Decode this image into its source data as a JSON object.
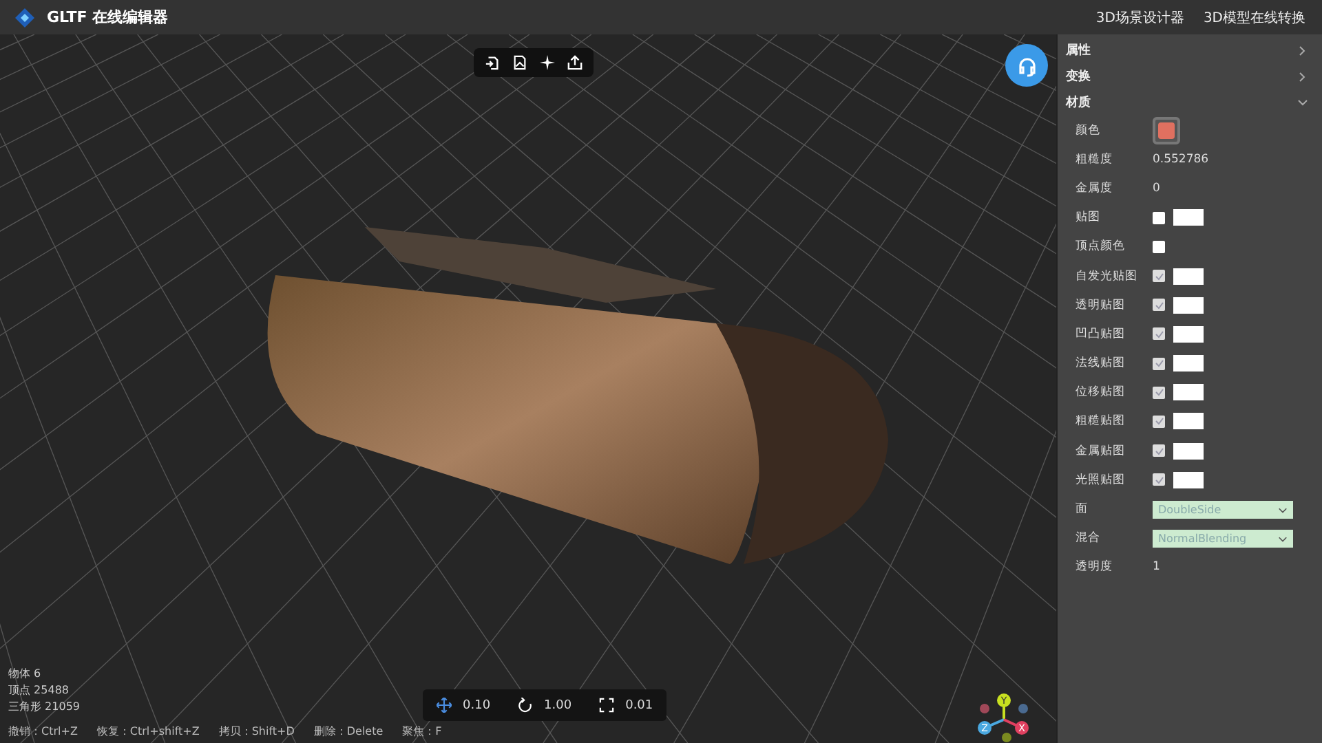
{
  "header": {
    "title": "GLTF 在线编辑器",
    "links": [
      "3D场景设计器",
      "3D模型在线转换"
    ]
  },
  "viewport": {
    "stats": [
      "物体 6",
      "顶点 25488",
      "三角形 21059"
    ],
    "shortcuts": [
      "撤销：Ctrl+Z",
      "恢复：Ctrl+shift+Z",
      "拷贝：Shift+D",
      "删除：Delete",
      "聚焦：F"
    ],
    "transform": [
      {
        "kind": "move",
        "value": "0.10"
      },
      {
        "kind": "rotate",
        "value": "1.00"
      },
      {
        "kind": "scale",
        "value": "0.01"
      }
    ],
    "axes": [
      "Y",
      "Z",
      "X"
    ]
  },
  "panel": {
    "sections": [
      {
        "title": "属性",
        "expanded": false
      },
      {
        "title": "变换",
        "expanded": false
      },
      {
        "title": "材质",
        "expanded": true
      }
    ],
    "rows": [
      {
        "kind": "color",
        "label": "颜色",
        "color": "#e07060"
      },
      {
        "kind": "value",
        "label": "粗糙度",
        "value": "0.552786"
      },
      {
        "kind": "value",
        "label": "金属度",
        "value": "0"
      },
      {
        "kind": "texture",
        "label": "贴图",
        "checked": false
      },
      {
        "kind": "check",
        "label": "顶点颜色",
        "checked": false
      },
      {
        "kind": "texture",
        "label": "自发光贴图",
        "checked": true
      },
      {
        "kind": "texture",
        "label": "透明贴图",
        "checked": true
      },
      {
        "kind": "texture",
        "label": "凹凸贴图",
        "checked": true
      },
      {
        "kind": "texture",
        "label": "法线贴图",
        "checked": true
      },
      {
        "kind": "texture",
        "label": "位移贴图",
        "checked": true
      },
      {
        "kind": "texture",
        "label": "粗糙贴图",
        "checked": true
      },
      {
        "kind": "texture",
        "label": "金属贴图",
        "checked": true
      },
      {
        "kind": "texture",
        "label": "光照贴图",
        "checked": true
      },
      {
        "kind": "select",
        "label": "面",
        "value": "DoubleSide"
      },
      {
        "kind": "select",
        "label": "混合",
        "value": "NormalBlending"
      },
      {
        "kind": "value",
        "label": "透明度",
        "value": "1"
      }
    ]
  }
}
